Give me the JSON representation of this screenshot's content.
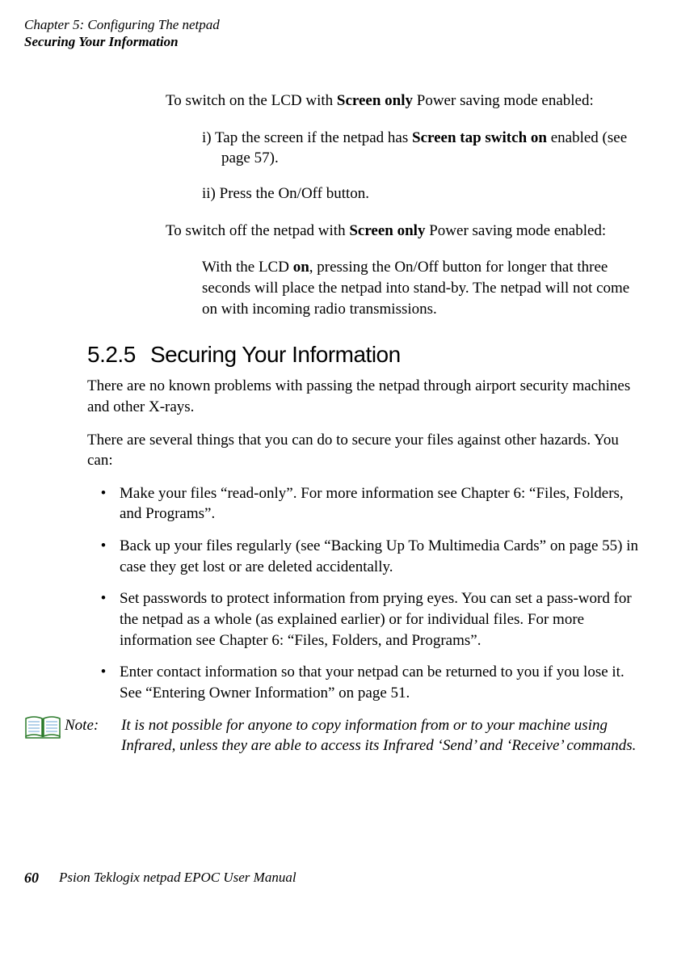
{
  "header": {
    "chapter": "Chapter 5:  Configuring The netpad",
    "section": "Securing Your Information"
  },
  "body": {
    "intro1_pre": "To switch on the LCD with ",
    "intro1_bold": "Screen only",
    "intro1_post": " Power saving mode enabled:",
    "sub1_pre": "i) Tap the screen if the netpad has ",
    "sub1_bold": "Screen tap switch on",
    "sub1_post": " enabled (see page 57).",
    "sub2": "ii) Press the On/Off button.",
    "intro2_pre": "To switch off the netpad with ",
    "intro2_bold": "Screen only",
    "intro2_post": " Power saving mode enabled:",
    "sub3_pre": "With the LCD ",
    "sub3_bold": "on",
    "sub3_post": ", pressing the On/Off button for longer that three seconds will place the netpad into stand-by. The netpad will not come on with incoming radio transmissions."
  },
  "heading": {
    "number": "5.2.5",
    "title": "Securing Your Information"
  },
  "main": {
    "p1": "There are no known problems with passing the netpad through airport security machines and other X-rays.",
    "p2": "There are several things that you can do to secure your files against other hazards. You can:",
    "bullets": [
      "Make your files “read-only”. For more information see Chapter 6: “Files, Folders, and Programs”.",
      "Back up your files regularly (see “Backing Up To Multimedia Cards” on page 55) in case they get lost or are deleted accidentally.",
      "Set passwords to protect information from prying eyes. You can set a pass-word for the netpad as a whole (as explained earlier) or for individual files. For more information see Chapter 6: “Files, Folders, and Programs”.",
      "Enter contact information so that your netpad can be returned to you if you lose it. See “Entering Owner Information” on page 51."
    ]
  },
  "note": {
    "label": "Note:",
    "text": "It is not possible for anyone to copy information from or to your machine using Infrared, unless they are able to access its Infrared ‘Send’ and ‘Receive’ commands."
  },
  "footer": {
    "page": "60",
    "manual": "Psion Teklogix netpad EPOC User Manual"
  }
}
